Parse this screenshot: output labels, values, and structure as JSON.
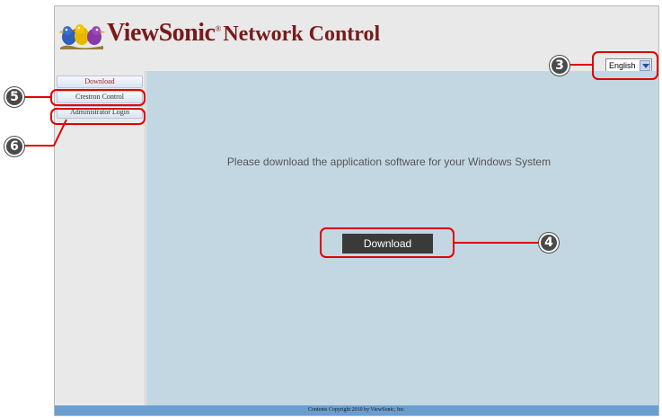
{
  "header": {
    "brand_name": "ViewSonic",
    "brand_registered": "®",
    "brand_subtitle": "Network Control",
    "logo_icon": "viewsonic-birds-logo"
  },
  "language": {
    "selected": "English"
  },
  "sidebar": {
    "items": [
      {
        "label": "Download",
        "active": true
      },
      {
        "label": "Crestron Control",
        "active": false
      },
      {
        "label": "Administrator Login",
        "active": false
      }
    ]
  },
  "main": {
    "message": "Please download the application software for your Windows System",
    "download_button": "Download"
  },
  "footer": {
    "text": "Contents Copyright 2010 by ViewSonic, Inc."
  },
  "callouts": {
    "c3": "3",
    "c4": "4",
    "c5": "5",
    "c6": "6"
  },
  "colors": {
    "brand": "#7a1a1a",
    "main_bg": "#c3d7e2",
    "button_bg": "#3a3a3a",
    "footer_bg": "#6a9ed0",
    "callout": "#e00000",
    "marker": "#4a4a4a"
  }
}
